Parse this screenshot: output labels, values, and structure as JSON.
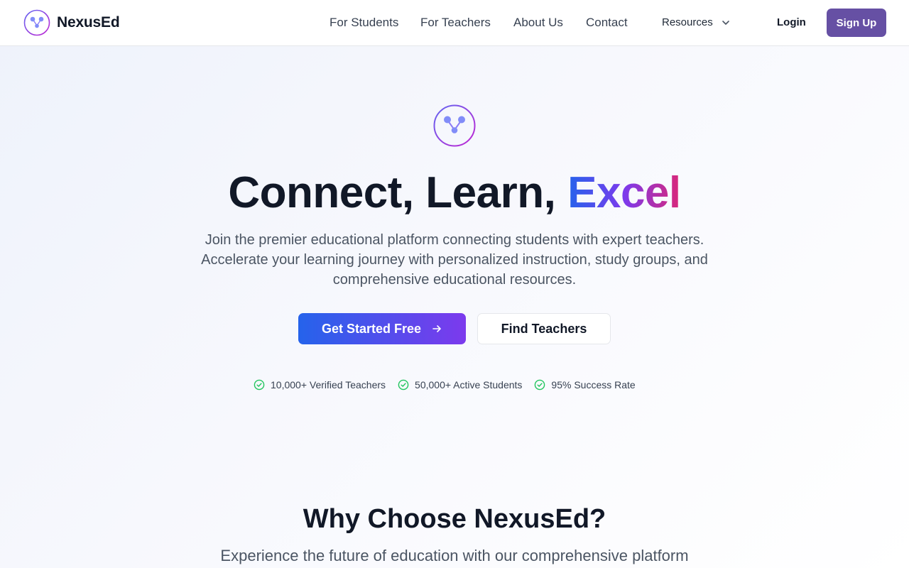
{
  "brand": {
    "name": "NexusEd"
  },
  "nav": {
    "links": [
      "For Students",
      "For Teachers",
      "About Us",
      "Contact"
    ],
    "resources_label": "Resources",
    "login_label": "Login",
    "signup_label": "Sign Up"
  },
  "hero": {
    "headline_main": "Connect, Learn, ",
    "headline_accent": "Excel",
    "subtitle": "Join the premier educational platform connecting students with expert teachers. Accelerate your learning journey with personalized instruction, study groups, and comprehensive educational resources.",
    "primary_cta": "Get Started Free",
    "secondary_cta": "Find Teachers",
    "stats": [
      "10,000+ Verified Teachers",
      "50,000+ Active Students",
      "95% Success Rate"
    ]
  },
  "why": {
    "title": "Why Choose NexusEd?",
    "subtitle": "Experience the future of education with our comprehensive platform"
  },
  "colors": {
    "brand_purple": "#6650a4",
    "gradient_blue": "#2563eb",
    "gradient_violet": "#7c3aed",
    "gradient_pink": "#db2777",
    "check_green": "#22c55e"
  },
  "icons": [
    "nexus-logo-icon",
    "chevron-down-icon",
    "arrow-right-icon",
    "check-circle-icon"
  ]
}
